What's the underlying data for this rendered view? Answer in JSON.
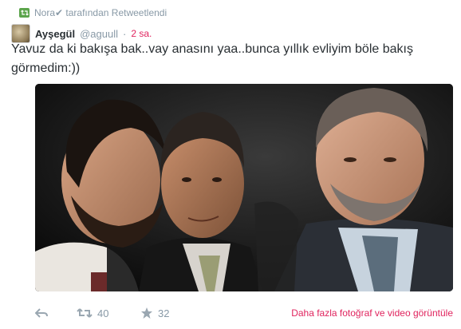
{
  "context": {
    "text": "Nora✔ tarafından Retweetlendi",
    "icon": "retweet-icon"
  },
  "tweet": {
    "fullname": "Ayşegül",
    "handle": "@aguull",
    "separator": "·",
    "time": "2 sa.",
    "text": "Yavuz da ki bakışa bak..vay anasını yaa..bunca yıllık evliyim böle bakış görmedim:))",
    "media_alt": "photo"
  },
  "actions": {
    "reply_icon": "reply-icon",
    "retweet_icon": "retweet-icon",
    "retweet_count": "40",
    "favorite_icon": "star-icon",
    "favorite_count": "32",
    "more_media_label": "Daha fazla fotoğraf ve video görüntüle"
  },
  "colors": {
    "accent": "#e0245e",
    "muted": "#8899a6",
    "retweet_green": "#5ba44b"
  }
}
